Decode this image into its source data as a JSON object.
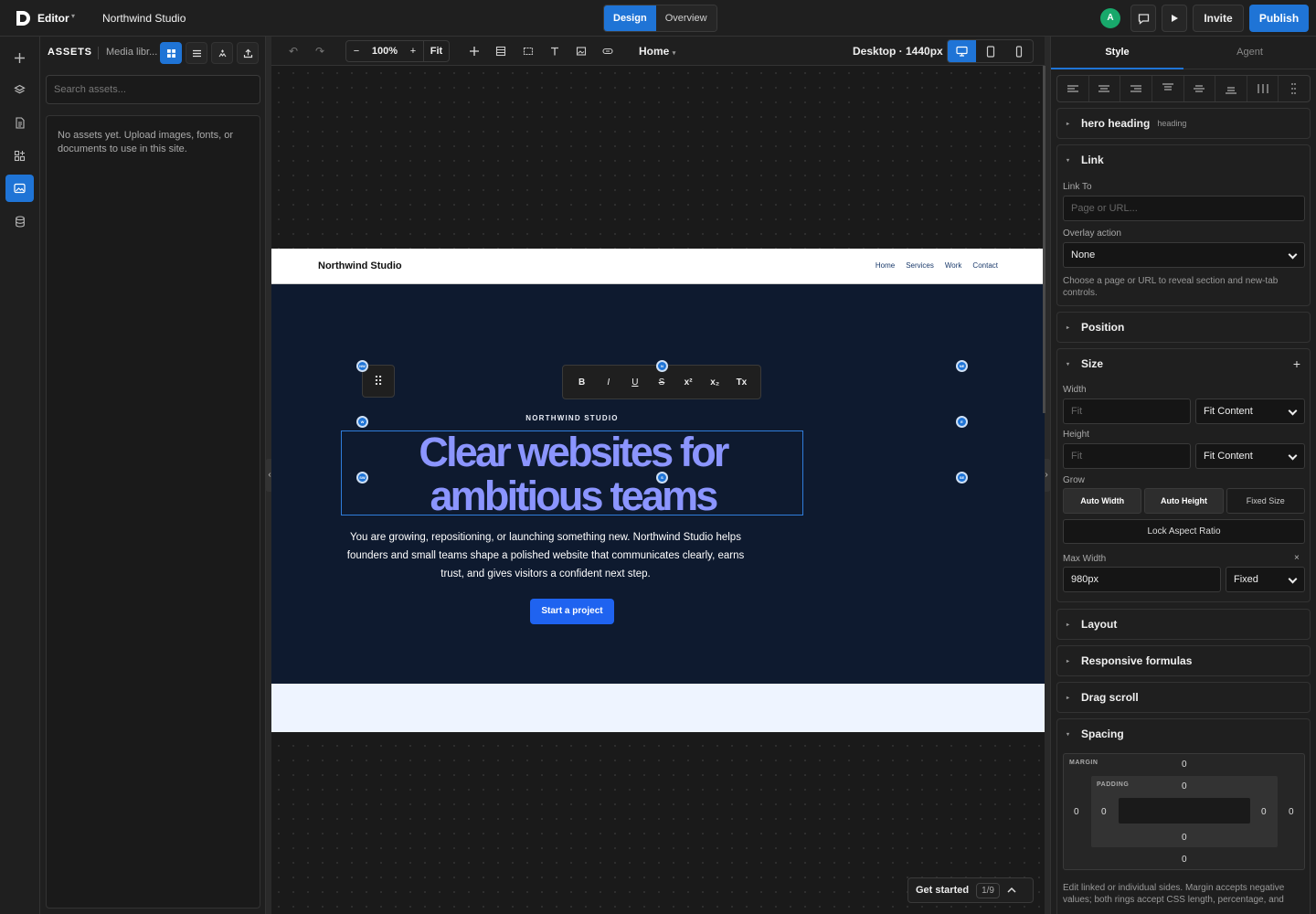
{
  "topbar": {
    "app_name": "Editor",
    "project_name": "Northwind Studio",
    "modes": [
      "Design",
      "Overview"
    ],
    "active_mode": "Design",
    "avatar_initial": "A",
    "invite_label": "Invite",
    "publish_label": "Publish"
  },
  "assets": {
    "title": "ASSETS",
    "subtitle": "Media libr...",
    "search_placeholder": "Search assets...",
    "empty_message": "No assets yet. Upload images, fonts, or documents to use in this site."
  },
  "canvas_toolbar": {
    "zoom_level": "100%",
    "zoom_out": "−",
    "zoom_in": "+",
    "fit_label": "Fit",
    "page": "Home",
    "breakpoint": "Desktop · 1440px"
  },
  "site": {
    "brand": "Northwind Studio",
    "nav_links": [
      "Home",
      "Services",
      "Work",
      "Contact"
    ],
    "eyebrow": "NORTHWIND STUDIO",
    "headline": "Clear websites for ambitious teams",
    "body": "You are growing, repositioning, or launching something new. Northwind Studio helps founders and small teams shape a polished website that communicates clearly, earns trust, and gives visitors a confident next step.",
    "cta": "Start a project",
    "colors": {
      "hero_bg": "#0e1a2f",
      "headline": "#8b95ff",
      "cta": "#1f63f0",
      "strip": "#eef4ff"
    }
  },
  "format_bar": [
    "B",
    "I",
    "U",
    "S",
    "x²",
    "x₂",
    "Tx"
  ],
  "handles": [
    "NW",
    "N",
    "NE",
    "W",
    "E",
    "SW",
    "S",
    "SE"
  ],
  "getting_started": {
    "label": "Get started",
    "progress": "1/9"
  },
  "right_panel": {
    "tabs": [
      "Style",
      "Agent"
    ],
    "active_tab": "Style",
    "element": {
      "name": "hero heading",
      "type": "heading"
    },
    "link": {
      "title": "Link",
      "link_to_label": "Link To",
      "link_to_placeholder": "Page or URL...",
      "overlay_label": "Overlay action",
      "overlay_value": "None",
      "help": "Choose a page or URL to reveal section and new-tab controls."
    },
    "position_title": "Position",
    "size": {
      "title": "Size",
      "width_label": "Width",
      "width_placeholder": "Fit",
      "width_mode": "Fit Content",
      "height_label": "Height",
      "height_placeholder": "Fit",
      "height_mode": "Fit Content",
      "grow_label": "Grow",
      "grow_options": [
        "Auto Width",
        "Auto Height",
        "Fixed Size"
      ],
      "lock_label": "Lock Aspect Ratio",
      "max_width_label": "Max Width",
      "max_width_value": "980px",
      "max_width_mode": "Fixed",
      "clear": "×"
    },
    "layout_title": "Layout",
    "responsive_title": "Responsive formulas",
    "drag_scroll_title": "Drag scroll",
    "spacing": {
      "title": "Spacing",
      "margin_label": "MARGIN",
      "padding_label": "PADDING",
      "margin": {
        "top": "0",
        "right": "0",
        "bottom": "0",
        "left": "0"
      },
      "padding": {
        "top": "0",
        "right": "0",
        "bottom": "0",
        "left": "0"
      },
      "help": "Edit linked or individual sides. Margin accepts negative values; both rings accept CSS length, percentage, and"
    }
  }
}
